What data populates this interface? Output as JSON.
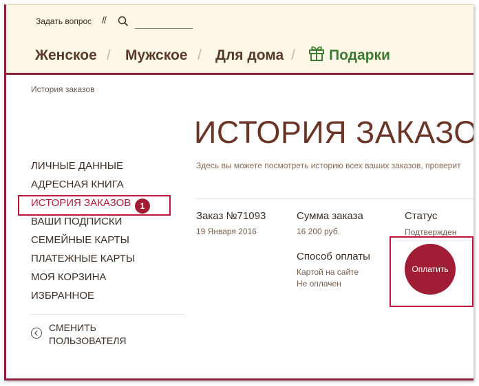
{
  "header": {
    "ask_label": "Задать вопрос",
    "separator": "//",
    "search": {
      "value": "",
      "placeholder": ""
    },
    "nav": [
      {
        "label": "Женское"
      },
      {
        "label": "Мужское"
      },
      {
        "label": "Для дома"
      },
      {
        "label": "Подарки",
        "icon": "gift-icon"
      }
    ],
    "nav_separator": "/"
  },
  "breadcrumb": "История заказов",
  "page_title": "ИСТОРИЯ ЗАКАЗОВ",
  "intro_text": "Здесь вы можете посмотреть историю всех ваших заказов, проверит",
  "sidebar": {
    "items": [
      {
        "label": "Личные данные"
      },
      {
        "label": "Адресная книга"
      },
      {
        "label": "История заказов",
        "active": true
      },
      {
        "label": "Ваши подписки"
      },
      {
        "label": "Семейные карты"
      },
      {
        "label": "Платежные карты"
      },
      {
        "label": "Моя корзина"
      },
      {
        "label": "Избранное"
      }
    ],
    "active_badge": "1",
    "switch_user": "СМЕНИТЬ ПОЛЬЗОВАТЕЛЯ"
  },
  "order": {
    "number_label": "Заказ №71093",
    "date": "19 Января 2016",
    "sum_label": "Сумма заказа",
    "sum_value": "16 200 руб.",
    "status_label": "Статус",
    "status_value": "Подтвержден",
    "payment_label": "Способ оплаты",
    "payment_method": "Картой на сайте",
    "payment_status": "Не оплачен",
    "pay_button": "Оплатить"
  },
  "colors": {
    "accent": "#a01d35",
    "highlight": "#c0143a",
    "header_bg": "#fcf7e6",
    "gift_green": "#3f7a34"
  }
}
